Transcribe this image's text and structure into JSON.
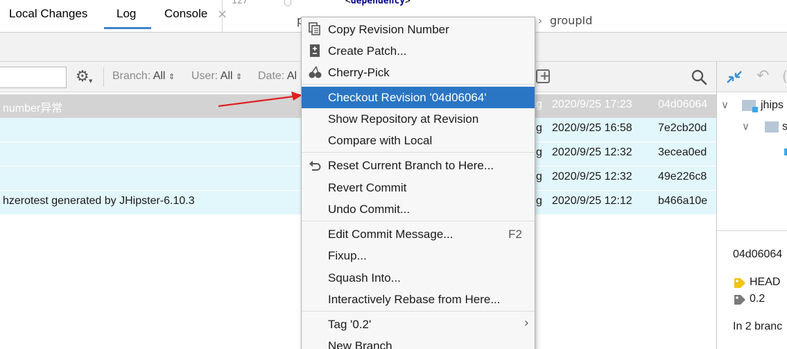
{
  "editor": {
    "line_number": "127",
    "xml_tag_name": "dependency",
    "breadcrumb_first": "p",
    "breadcrumb_second": "groupId"
  },
  "tabs": [
    {
      "label": "Local Changes"
    },
    {
      "label": "Log"
    },
    {
      "label": "Console"
    }
  ],
  "filters": {
    "branch_label": "Branch:",
    "branch_value": "All",
    "user_label": "User:",
    "user_value": "All",
    "date_label": "Date:",
    "date_value": "Al"
  },
  "commits": [
    {
      "message": "number异常",
      "author": "g",
      "date": "2020/9/25 17:23",
      "hash": "04d06064"
    },
    {
      "message": "",
      "author": "g",
      "date": "2020/9/25 16:58",
      "hash": "7e2cb20d"
    },
    {
      "message": "",
      "author": "g",
      "date": "2020/9/25 12:32",
      "hash": "3ecea0ed"
    },
    {
      "message": "",
      "author": "g",
      "date": "2020/9/25 12:32",
      "hash": "49e226c8"
    },
    {
      "message": "hzerotest generated by JHipster-6.10.3",
      "author": "g",
      "date": "2020/9/25 12:12",
      "hash": "b466a10e"
    }
  ],
  "right_panel": {
    "tree_root": "jhips",
    "tree_child": "s",
    "commit_hash": "04d06064",
    "head_tag": "HEAD",
    "version_tag": "0.2",
    "branches_text": "In 2 branc"
  },
  "context_menu": {
    "items": [
      {
        "label": "Copy Revision Number",
        "icon": "copy-icon"
      },
      {
        "label": "Create Patch...",
        "icon": "patch-icon"
      },
      {
        "label": "Cherry-Pick",
        "icon": "cherry-icon"
      },
      {
        "label": "Checkout Revision '04d06064'"
      },
      {
        "label": "Show Repository at Revision"
      },
      {
        "label": "Compare with Local"
      },
      {
        "label": "Reset Current Branch to Here...",
        "icon": "undo-icon"
      },
      {
        "label": "Revert Commit"
      },
      {
        "label": "Undo Commit..."
      },
      {
        "label": "Edit Commit Message...",
        "shortcut": "F2"
      },
      {
        "label": "Fixup..."
      },
      {
        "label": "Squash Into..."
      },
      {
        "label": "Interactively Rebase from Here..."
      },
      {
        "label": "Tag '0.2'"
      },
      {
        "label": "New Branch"
      }
    ]
  },
  "colors": {
    "highlight": "#2a75c4",
    "selected_row": "#d3d3d3",
    "branch_row": "#e2f7fb",
    "arrow": "#e02020",
    "head_tag": "#f2c30f"
  }
}
